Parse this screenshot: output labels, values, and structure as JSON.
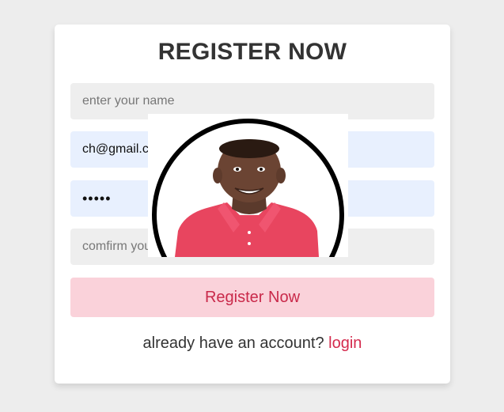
{
  "form": {
    "title": "REGISTER NOW",
    "name_placeholder": "enter your name",
    "email_value": "ch@gmail.com",
    "password_value": "•••••",
    "confirm_placeholder": "comfirm your password",
    "submit_label": "Register Now",
    "footer_text": "already have an account?",
    "login_link": "login"
  },
  "colors": {
    "page_bg": "#ededed",
    "accent": "#d42a4d",
    "button_bg": "#fad2da",
    "autofill_bg": "#e8f0fe"
  }
}
